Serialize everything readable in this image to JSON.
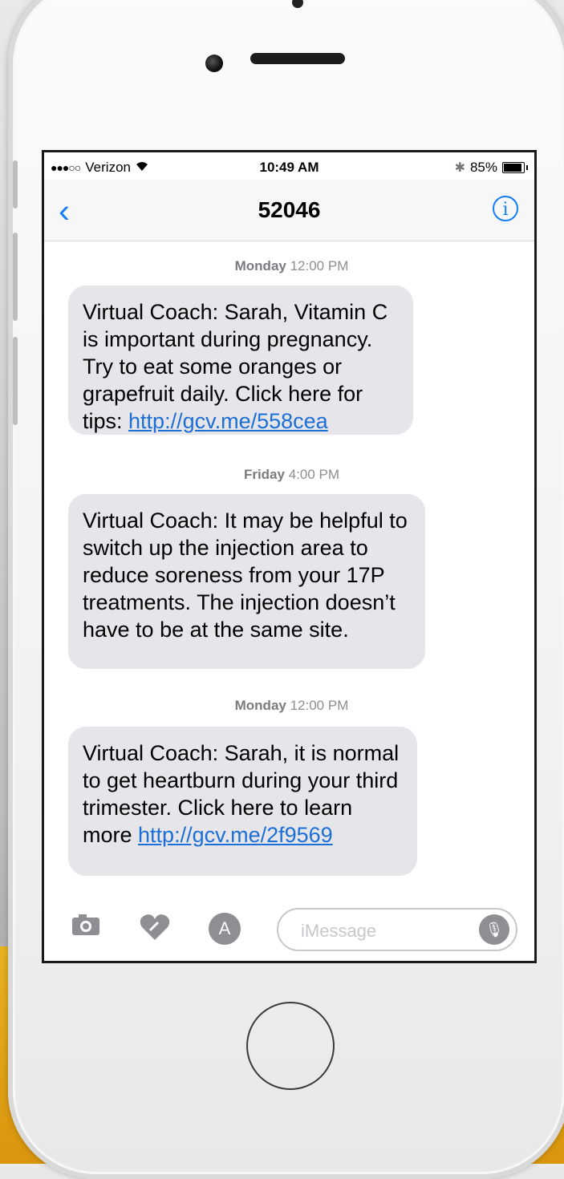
{
  "status": {
    "carrier": "Verizon",
    "signal": "●●●○○",
    "wifi_icon": "wifi-icon",
    "time": "10:49 AM",
    "battery_percent": "85%",
    "bluetooth_icon": "bluetooth-icon"
  },
  "nav": {
    "back_symbol": "‹",
    "title": "52046",
    "info_symbol": "i"
  },
  "messages": [
    {
      "day": "Monday",
      "time": "12:00 PM",
      "text": "Virtual Coach: Sarah, Vitamin C is important during pregnancy. Try to eat some oranges or grapefruit daily. Click here for tips: ",
      "link": "http://gcv.me/558cea"
    },
    {
      "day": "Friday",
      "time": "4:00 PM",
      "text": "Virtual Coach: It may be helpful to switch up the injection area to reduce soreness from your 17P treatments. The injection doesn’t have to be at the same site.",
      "link": ""
    },
    {
      "day": "Monday",
      "time": "12:00 PM",
      "text": "Virtual Coach: Sarah, it is normal to get heartburn during your third trimester. Click here to learn more ",
      "link": "http://gcv.me/2f9569"
    }
  ],
  "input": {
    "placeholder": "iMessage",
    "camera_icon": "camera-icon",
    "heart_icon": "heart-icon",
    "appstore_icon": "appstore-icon",
    "mic_icon": "microphone-icon"
  },
  "colors": {
    "accent": "#147efb",
    "bubble": "#e5e5ea",
    "link": "#1c6fd6"
  }
}
